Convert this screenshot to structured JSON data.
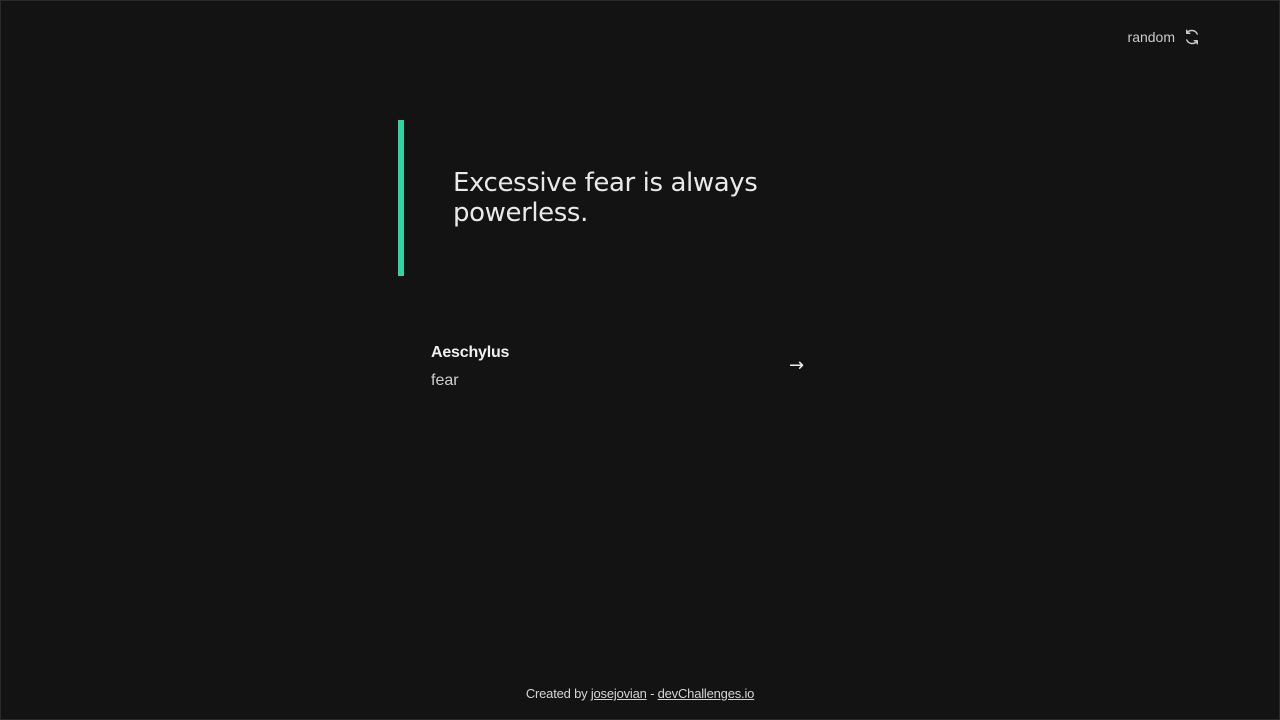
{
  "header": {
    "random_label": "random",
    "random_icon": "refresh-icon"
  },
  "quote": {
    "text": "Excessive fear is always powerless.",
    "accent_color": "#2fd4a2"
  },
  "author": {
    "name": "Aeschylus",
    "genre": "fear",
    "arrow": "→"
  },
  "footer": {
    "prefix": "Created by ",
    "author_link": "josejovian",
    "separator": " - ",
    "site_link": "devChallenges.io"
  }
}
